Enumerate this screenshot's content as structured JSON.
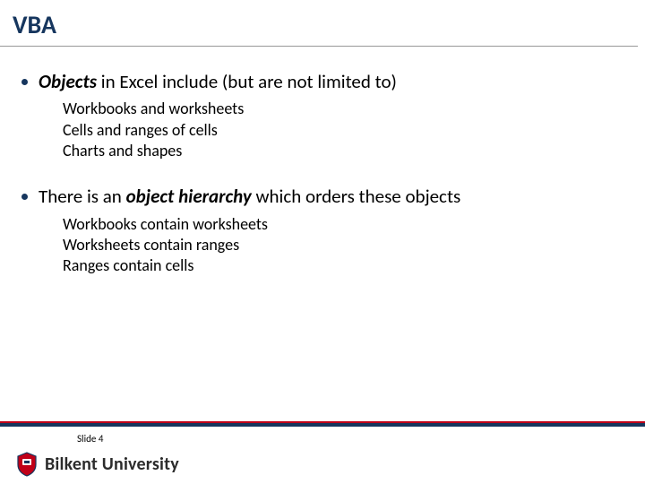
{
  "title": "VBA",
  "bullets": [
    {
      "lead_bi": "Objects",
      "rest": " in Excel include (but are not limited to)",
      "subs": [
        "Workbooks and worksheets",
        "Cells and ranges of cells",
        "Charts and shapes"
      ]
    },
    {
      "pre": "There is an ",
      "bi2": "object hierarchy",
      "rest2": " which orders these objects",
      "subs": [
        "Workbooks contain worksheets",
        "Worksheets contain ranges",
        "Ranges contain cells"
      ]
    }
  ],
  "footer": {
    "slide_label": "Slide 4",
    "university": "Bilkent University"
  }
}
